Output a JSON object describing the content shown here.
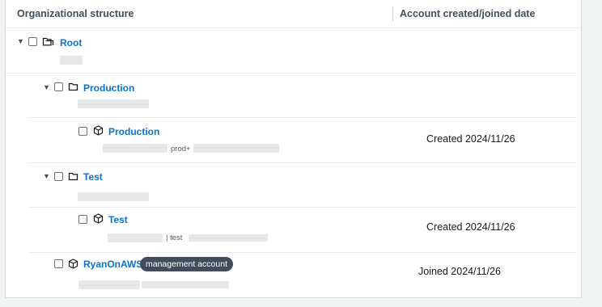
{
  "table": {
    "col_structure": "Organizational structure",
    "col_date": "Account created/joined date"
  },
  "nodes": {
    "root": {
      "label": "Root"
    },
    "production_ou": {
      "label": "Production"
    },
    "production_acct": {
      "label": "Production",
      "email_prefix": "prod+",
      "date": "Created 2024/11/26"
    },
    "test_ou": {
      "label": "Test"
    },
    "test_acct": {
      "label": "Test",
      "email_prefix": "| test",
      "date": "Created 2024/11/26"
    },
    "mgmt_acct": {
      "label": "RyanOnAWS",
      "badge": "management account",
      "date": "Joined 2024/11/26"
    }
  },
  "icons": {
    "expand": "caret-down-icon",
    "ou": "folder-icon",
    "root": "folders-icon",
    "account": "cube-icon"
  },
  "colors": {
    "link": "#0972d3",
    "badge_bg": "#414d5c",
    "header_text": "#414d5c",
    "page_bg": "#f2f3f3"
  }
}
